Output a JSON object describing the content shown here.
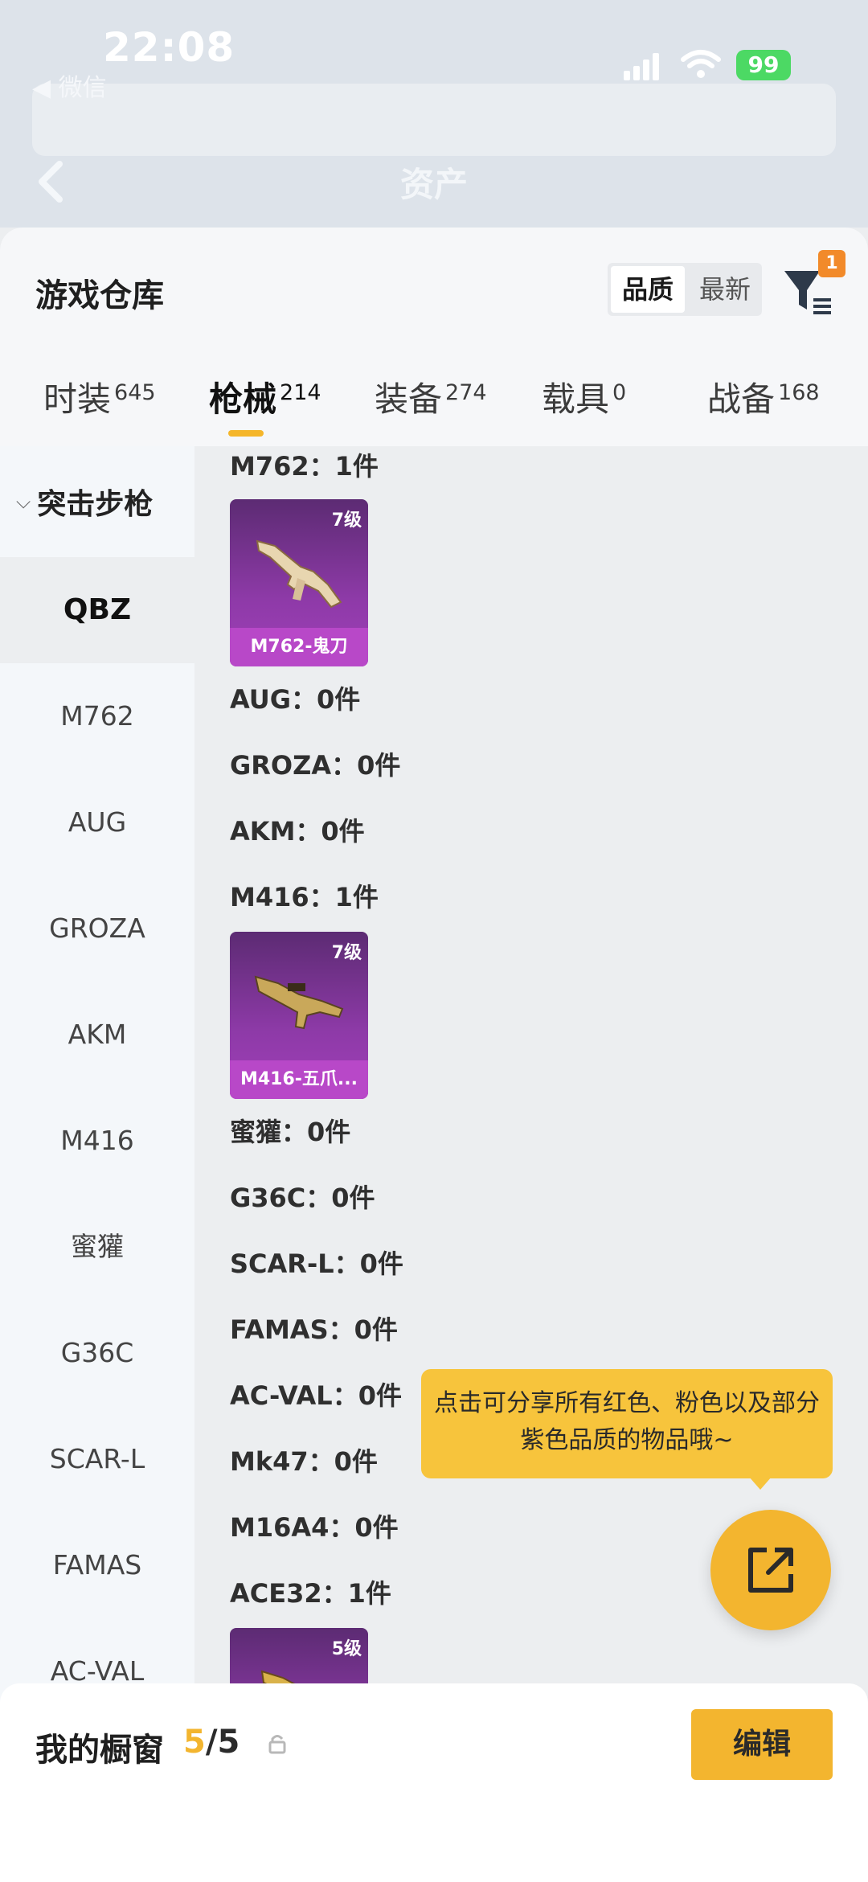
{
  "status": {
    "time": "22:08",
    "back_app": "◀ 微信",
    "battery": "99"
  },
  "nav": {
    "title": "资产"
  },
  "header": {
    "title": "游戏仓库",
    "sort": {
      "quality": "品质",
      "newest": "最新"
    },
    "filter_badge": "1"
  },
  "tabs": [
    {
      "label": "时装",
      "count": "645"
    },
    {
      "label": "枪械",
      "count": "214"
    },
    {
      "label": "装备",
      "count": "274"
    },
    {
      "label": "载具",
      "count": "0"
    },
    {
      "label": "战备",
      "count": "168"
    }
  ],
  "sidebar": {
    "category": "突击步枪",
    "items": [
      "QBZ",
      "M762",
      "AUG",
      "GROZA",
      "AKM",
      "M416",
      "蜜獾",
      "G36C",
      "SCAR-L",
      "FAMAS",
      "AC-VAL"
    ]
  },
  "content": {
    "rows": [
      "M762：1件",
      "AUG：0件",
      "GROZA：0件",
      "AKM：0件",
      "M416：1件",
      "蜜獾：0件",
      "G36C：0件",
      "SCAR-L：0件",
      "FAMAS：0件",
      "AC-VAL：0件",
      "Mk47：0件",
      "M16A4：0件",
      "ACE32：1件"
    ],
    "cards": [
      {
        "level": "7级",
        "name": "M762-鬼刀"
      },
      {
        "level": "7级",
        "name": "M416-五爪..."
      },
      {
        "level": "5级",
        "name": ""
      }
    ]
  },
  "tooltip": {
    "text": "点击可分享所有红色、粉色以及部分紫色品质的物品哦~"
  },
  "bottom": {
    "label": "我的橱窗",
    "used": "5",
    "total": "/5",
    "edit": "编辑"
  },
  "colors": {
    "accent": "#f3b52f",
    "card_purple": "#8e3aa8"
  }
}
